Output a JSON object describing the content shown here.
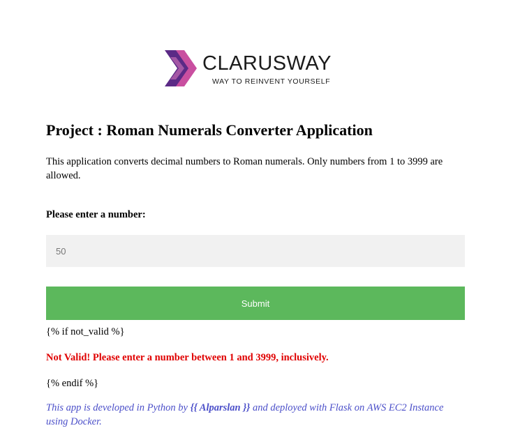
{
  "brand": {
    "name": "CLARUSWAY",
    "tagline": "WAY TO REINVENT YOURSELF",
    "logo_icon": "chevron-arrows-icon",
    "colors": {
      "chevron_dark": "#5b2a86",
      "chevron_light": "#c94fa0"
    }
  },
  "page": {
    "title": "Project : Roman Numerals Converter Application",
    "description": "This application converts decimal numbers to Roman numerals. Only numbers from 1 to 3999 are allowed."
  },
  "form": {
    "label": "Please enter a number:",
    "input_value": "50",
    "submit_label": "Submit",
    "submit_color": "#5cb85c"
  },
  "template": {
    "if_tag": "{% if not_valid %}",
    "error_message": "Not Valid! Please enter a number between 1 and 3999, inclusively.",
    "endif_tag": "{% endif %}"
  },
  "footer": {
    "prefix": "This app is developed in Python by ",
    "author": "{{ Alparslan }}",
    "suffix": " and deployed with Flask on AWS EC2 Instance using Docker."
  }
}
